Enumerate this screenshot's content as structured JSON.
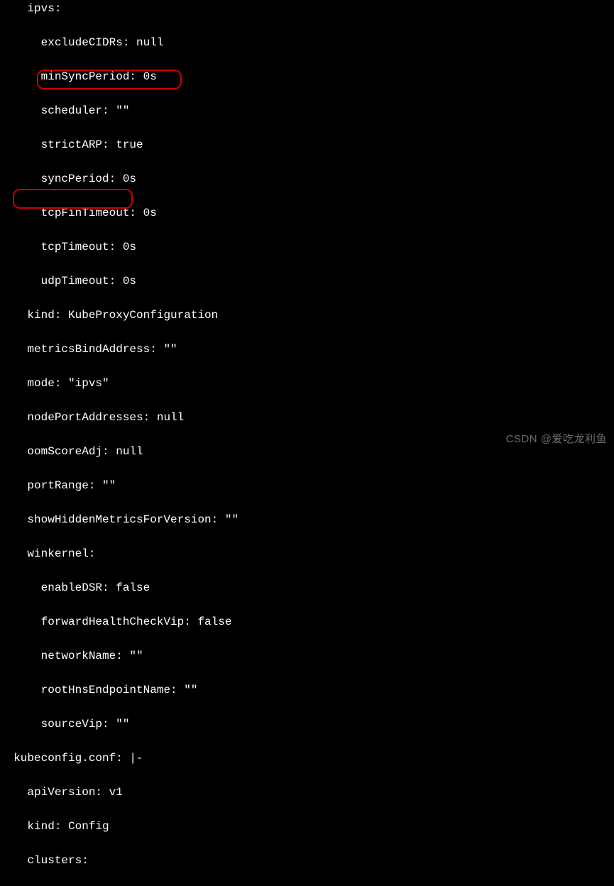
{
  "lines": {
    "l0": "    ipvs:",
    "l1": "      excludeCIDRs: null",
    "l2": "      minSyncPeriod: 0s",
    "l3": "      scheduler: \"\"",
    "l4": "      strictARP: true",
    "l5": "      syncPeriod: 0s",
    "l6": "      tcpFinTimeout: 0s",
    "l7": "      tcpTimeout: 0s",
    "l8": "      udpTimeout: 0s",
    "l9": "    kind: KubeProxyConfiguration",
    "l10": "    metricsBindAddress: \"\"",
    "l11": "    mode: \"ipvs\"",
    "l12": "    nodePortAddresses: null",
    "l13": "    oomScoreAdj: null",
    "l14": "    portRange: \"\"",
    "l15": "    showHiddenMetricsForVersion: \"\"",
    "l16": "    winkernel:",
    "l17": "      enableDSR: false",
    "l18": "      forwardHealthCheckVip: false",
    "l19": "      networkName: \"\"",
    "l20": "      rootHnsEndpointName: \"\"",
    "l21": "      sourceVip: \"\"",
    "l22": "  kubeconfig.conf: |-",
    "l23": "    apiVersion: v1",
    "l24": "    kind: Config",
    "l25": "    clusters:"
  },
  "watermark": "CSDN @爱吃龙利鱼",
  "annotations": [
    {
      "target": "strictARP: true",
      "desc": "highlighted-box-1"
    },
    {
      "target": "mode: \"ipvs\"",
      "desc": "highlighted-box-2"
    }
  ]
}
